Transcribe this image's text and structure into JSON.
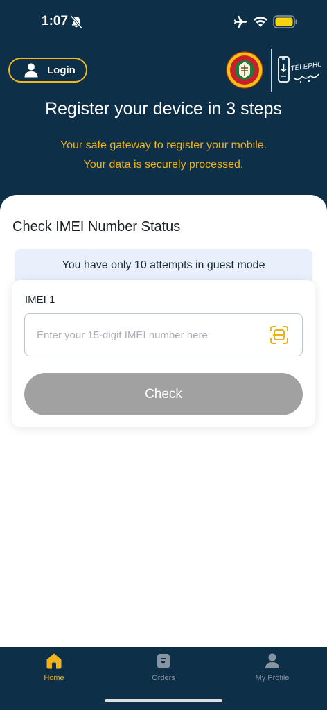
{
  "status_bar": {
    "time": "1:07",
    "icons": [
      "bell-off-icon",
      "airplane-icon",
      "wifi-icon",
      "battery-icon"
    ],
    "battery_color": "#f5d30f"
  },
  "header": {
    "login_label": "Login",
    "logo_emblem": "customs-emblem",
    "logo_telephony": "TELEPHONY",
    "headline": "Register your device in 3 steps",
    "subline_1": "Your safe gateway to register your mobile.",
    "subline_2": "Your data is securely processed.",
    "background_color": "#0d2f47",
    "accent_color": "#f0b21d"
  },
  "main": {
    "section_title": "Check IMEI Number Status",
    "attempts_banner": "You have only 10 attempts in guest mode",
    "imei_label": "IMEI 1",
    "imei_value": "",
    "imei_placeholder": "Enter your 15-digit IMEI number here",
    "check_label": "Check",
    "check_button_color": "#a1a1a1"
  },
  "bottom_nav": {
    "items": [
      {
        "label": "Home",
        "icon": "home-icon",
        "active": true
      },
      {
        "label": "Orders",
        "icon": "orders-icon",
        "active": false
      },
      {
        "label": "My Profile",
        "icon": "profile-icon",
        "active": false
      }
    ]
  }
}
